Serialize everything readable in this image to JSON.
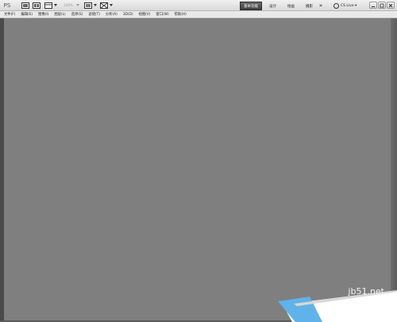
{
  "appbar": {
    "logo_text": "PS",
    "zoom_value": "100%",
    "workspaces": [
      {
        "label": "基本功能",
        "active": true
      },
      {
        "label": "设计",
        "active": false
      },
      {
        "label": "绘画",
        "active": false
      },
      {
        "label": "摄影",
        "active": false
      }
    ],
    "more_label": "»",
    "cslive_label": "CS Live ▾",
    "window_controls": [
      "minimize-icon",
      "restore-icon",
      "close-icon"
    ]
  },
  "menubar": {
    "items": [
      "文件(F)",
      "编辑(E)",
      "图像(I)",
      "图层(L)",
      "选择(S)",
      "滤镜(T)",
      "分析(A)",
      "3D(D)",
      "视图(V)",
      "窗口(W)",
      "帮助(H)"
    ]
  },
  "watermark": {
    "site": "jb51.net",
    "name": "脚本之家"
  },
  "colors": {
    "workspace_bg": "#7f7f7f",
    "left_edge": "#4b4b4b",
    "active_workspace": "#4a4a4a"
  }
}
